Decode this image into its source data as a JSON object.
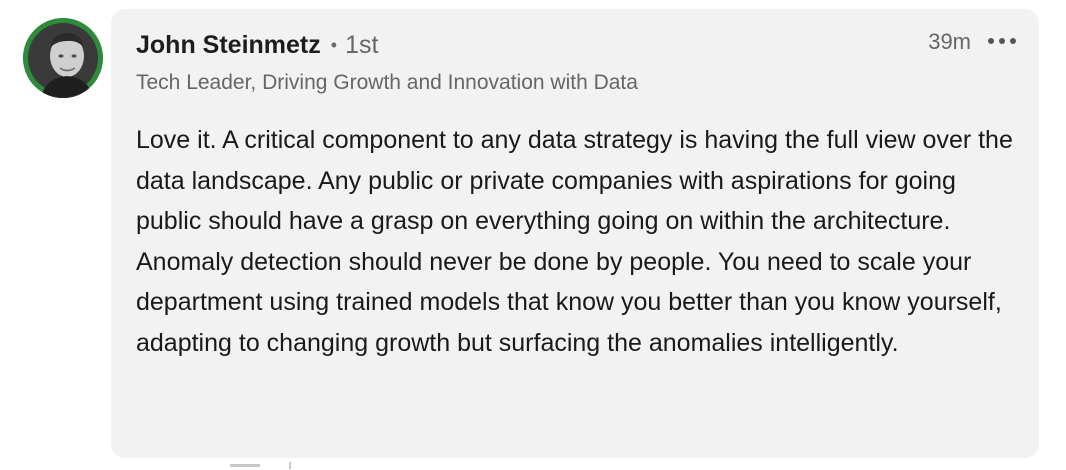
{
  "comment": {
    "author": {
      "name": "John Steinmetz",
      "connection_separator": "•",
      "connection_degree": "1st",
      "headline": "Tech Leader, Driving Growth and Innovation with Data",
      "avatar_icon": "profile-photo"
    },
    "timestamp": "39m",
    "more_icon": "ellipsis-horizontal-icon",
    "text": "Love it. A critical component to any data strategy is having the full view over the data landscape. Any public or private companies with aspirations for going public should have a grasp on everything going on within the architecture. Anomaly detection should never be done by people. You need to scale your department using trained models that know you better than you know yourself, adapting to changing growth but surfacing the anomalies intelligently."
  },
  "colors": {
    "bubble_background": "#f2f2f2",
    "avatar_ring": "#2e8b3a",
    "text_primary": "#1a1a1a",
    "text_secondary": "#666666"
  }
}
